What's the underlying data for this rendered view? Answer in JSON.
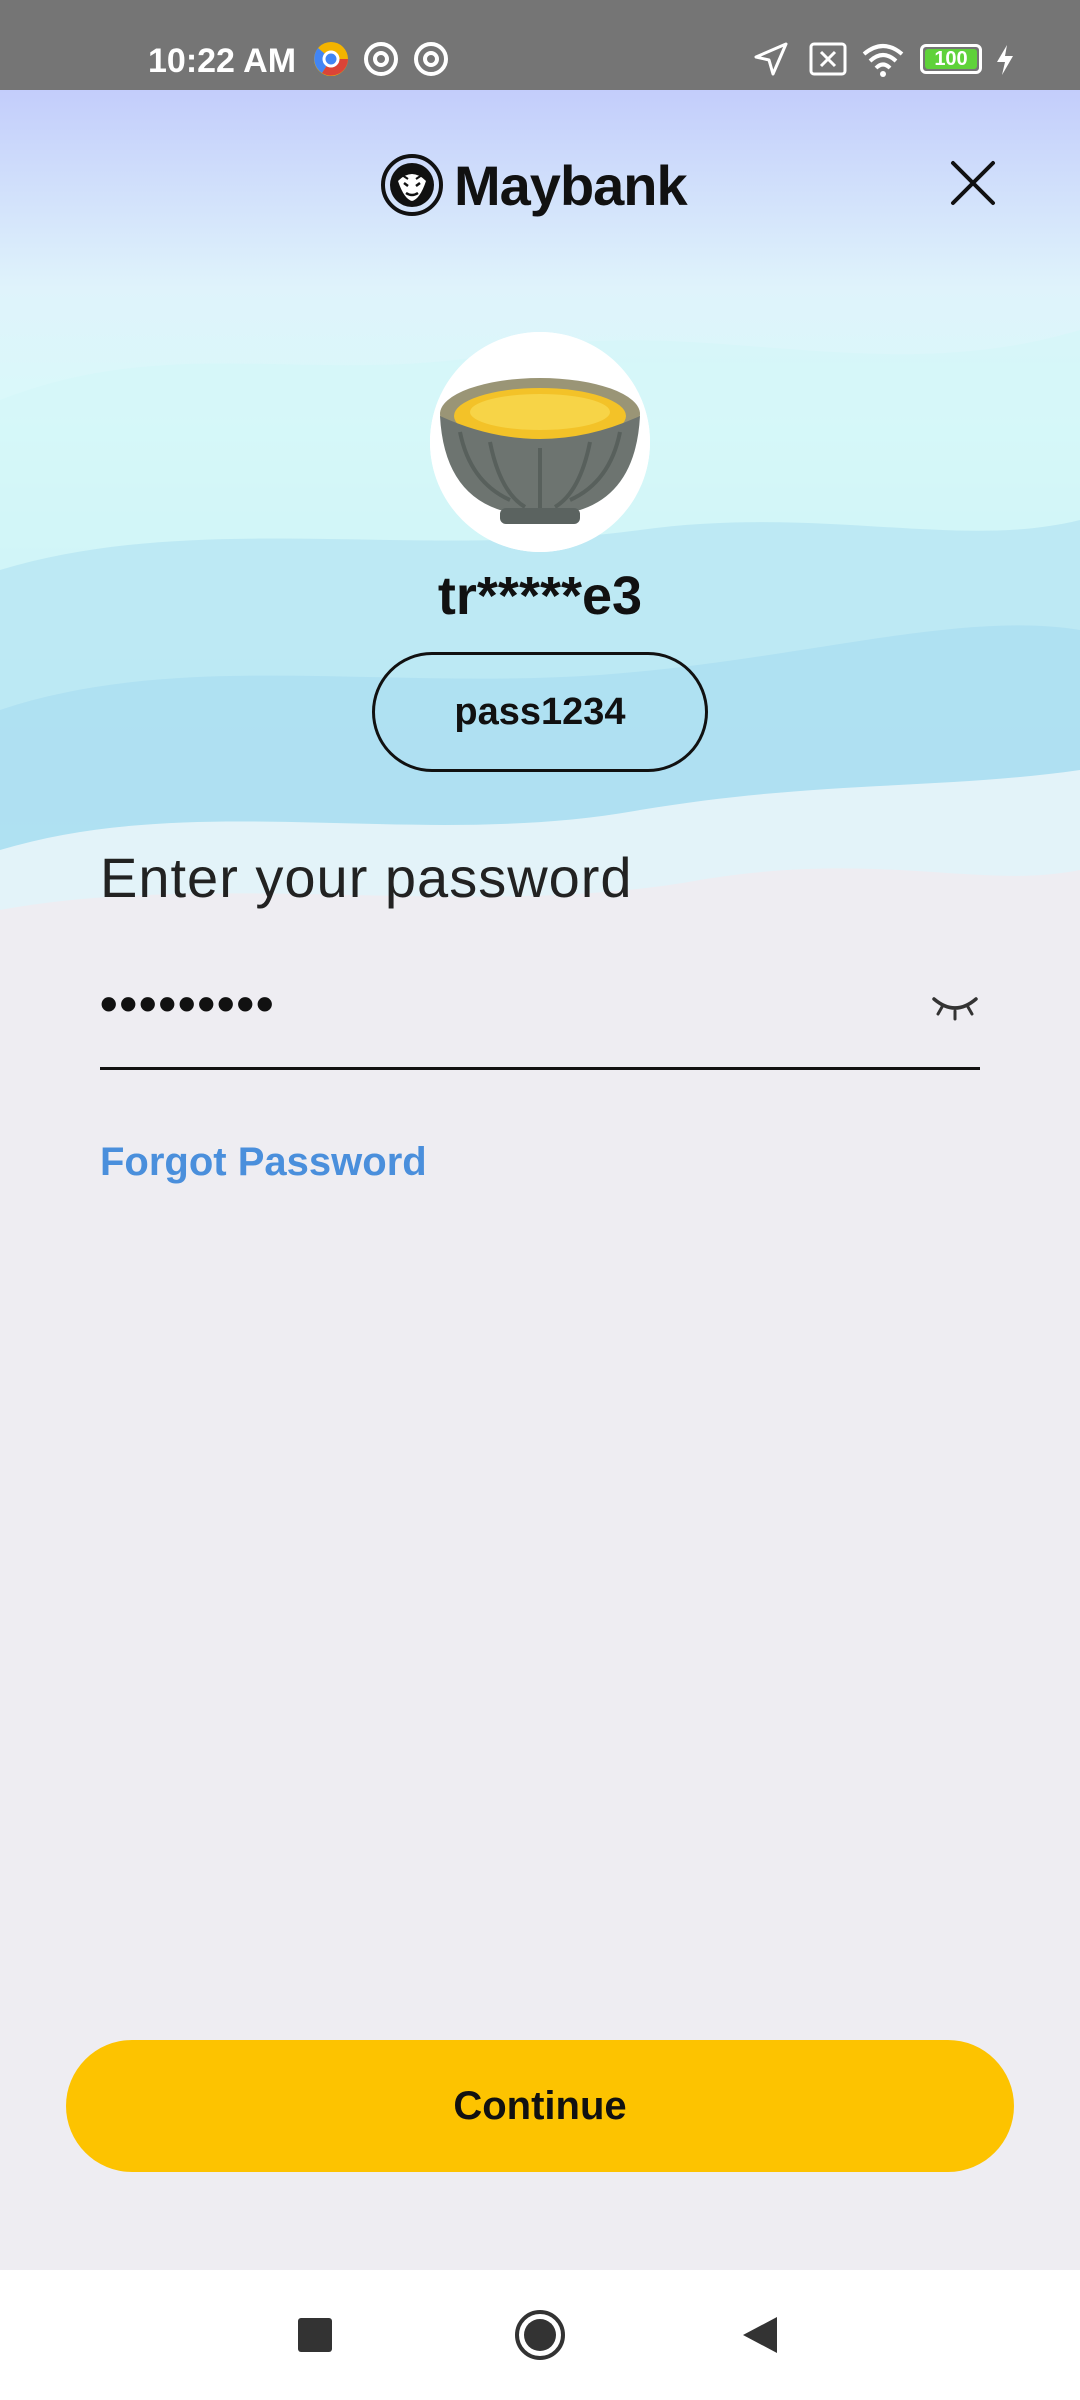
{
  "status_bar": {
    "time": "10:22 AM",
    "battery": "100",
    "icons": [
      "chrome-icon",
      "notification-icon",
      "notification-icon",
      "location-arrow-icon",
      "sim-x-icon",
      "wifi-icon",
      "battery-icon",
      "charging-icon"
    ]
  },
  "header": {
    "brand": "Maybank",
    "close_icon": "close-icon"
  },
  "profile": {
    "username": "tr*****e3",
    "secure_phrase": "pass1234"
  },
  "login": {
    "prompt": "Enter your password",
    "password_value": "•••••••••",
    "forgot_label": "Forgot Password",
    "eye_icon": "eye-closed-icon"
  },
  "actions": {
    "continue_label": "Continue"
  },
  "nav": {
    "icons": [
      "recents-square-icon",
      "home-circle-icon",
      "back-triangle-icon"
    ]
  },
  "colors": {
    "accent": "#fdc300",
    "link": "#4a8fdc",
    "background": "#eeedf2"
  }
}
